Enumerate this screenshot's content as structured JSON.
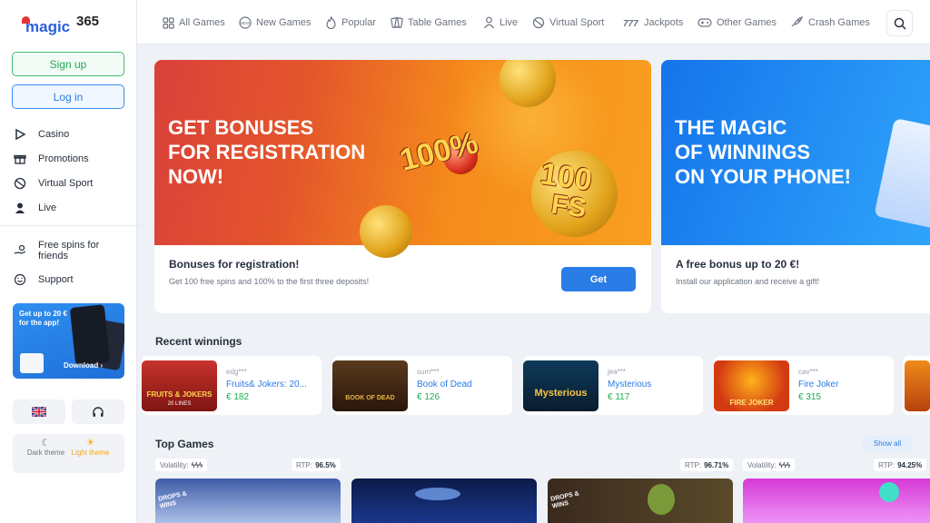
{
  "logo": {
    "word": "magic",
    "digits": "365"
  },
  "auth": {
    "signup": "Sign up",
    "login": "Log in"
  },
  "sidebar": {
    "items": [
      {
        "label": "Casino",
        "icon": "play-icon"
      },
      {
        "label": "Promotions",
        "icon": "gift-icon"
      },
      {
        "label": "Virtual Sport",
        "icon": "ball-icon"
      },
      {
        "label": "Live",
        "icon": "dealer-icon"
      },
      {
        "label": "Free spins for friends",
        "icon": "hand-coin-icon"
      },
      {
        "label": "Support",
        "icon": "smile-icon"
      }
    ],
    "promo": {
      "text": "Get up to 20 € for the app!",
      "download": "Download"
    },
    "theme": {
      "dark": "Dark theme",
      "light": "Light theme"
    }
  },
  "topnav": [
    {
      "label": "All Games",
      "icon": "grid-icon"
    },
    {
      "label": "New Games",
      "icon": "new-badge-icon"
    },
    {
      "label": "Popular",
      "icon": "flame-icon"
    },
    {
      "label": "Table Games",
      "icon": "cards-icon"
    },
    {
      "label": "Live",
      "icon": "dealer-icon"
    },
    {
      "label": "Virtual Sport",
      "icon": "ball-icon"
    },
    {
      "label": "Jackpots",
      "icon": "777-icon"
    },
    {
      "label": "Other Games",
      "icon": "gamepad-icon"
    },
    {
      "label": "Crash Games",
      "icon": "rocket-icon"
    }
  ],
  "banners": [
    {
      "headline": [
        "GET BONUSES",
        "FOR REGISTRATION",
        "NOW!"
      ],
      "badge_pct": "100%",
      "badge_fs_1": "100",
      "badge_fs_2": "FS",
      "title": "Bonuses for registration!",
      "desc": "Get 100 free spins and 100% to the first three deposits!",
      "button": "Get"
    },
    {
      "headline": [
        "THE MAGIC",
        "OF WINNINGS",
        "ON YOUR PHONE!"
      ],
      "title": "A free bonus up to 20 €!",
      "desc": "Install our application and receive a gift!"
    }
  ],
  "recent": {
    "title": "Recent winnings",
    "items": [
      {
        "user": "edg***",
        "game": "Fruits& Jokers: 20...",
        "amount": "€ 182",
        "thumb_text": "FRUITS & JOKERS",
        "thumb_sub": "20 LINES"
      },
      {
        "user": "sum***",
        "game": "Book of Dead",
        "amount": "€ 126",
        "thumb_text": "BOOK OF DEAD"
      },
      {
        "user": "jea***",
        "game": "Mysterious",
        "amount": "€ 117",
        "thumb_text": "Mysterious"
      },
      {
        "user": "cav***",
        "game": "Fire Joker",
        "amount": "€ 315",
        "thumb_text": "FIRE JOKER"
      }
    ]
  },
  "top_games": {
    "title": "Top Games",
    "show_all": "Show all",
    "volatility_label": "Volatility:",
    "rtp_label": "RTP:",
    "rtp_values": [
      "96.5%",
      "96.71%",
      "94.25%"
    ],
    "card_badge": "DROPS & WINS"
  },
  "colors": {
    "primary": "#2a7ce6",
    "success": "#1faa50",
    "bg": "#eef1f5"
  }
}
